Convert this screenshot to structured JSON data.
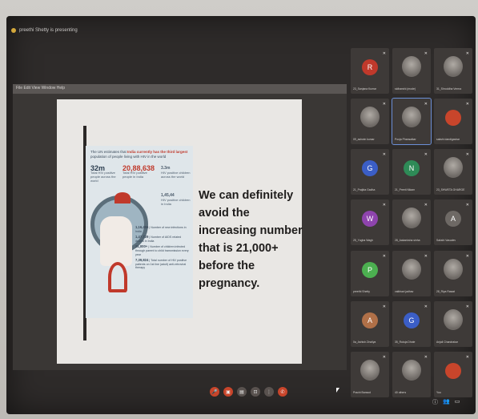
{
  "meeting": {
    "presenting_label": "preethi Shetty is presenting"
  },
  "share_window": {
    "menu_label": "File  Edit  View  Window  Help"
  },
  "infographic": {
    "headline_pre": "The UN estimates that ",
    "headline_emph": "India currently has the third largest",
    "headline_post": " population of people living with HIV in the world",
    "stat1_value": "32m",
    "stat1_label": "Total HIV positive people across the world",
    "stat2_value": "20,88,638",
    "stat2_label": "Total HIV positive people in India",
    "stat3_value": "3.3m",
    "stat3_label": "HIV positive children across the world",
    "stat4_value": "1,45,44",
    "stat4_label": "HIV positive children in India",
    "bullets": [
      {
        "value": "1,16,456",
        "label": "Number of new infections in India"
      },
      {
        "value": "1,47,729",
        "label": "Number of AIDS related deaths in India"
      },
      {
        "value": "21,000+",
        "label": "Number of children infected through parent to child transmission every year"
      },
      {
        "value": "7,39,824",
        "label": "Total number of HIV positive patients on 1st line (adult) anti-retroviral therapy"
      }
    ]
  },
  "slide_text": "We can definitely avoid the increasing number that is 21,000+ before the pregnancy.",
  "participants": [
    {
      "name": "23_Sanjana Kumar",
      "type": "avatar",
      "initial": "R",
      "color": "#c0392b"
    },
    {
      "name": "sidhanshi (mode)",
      "type": "photo"
    },
    {
      "name": "31_Shruddha Verma",
      "type": "photo"
    },
    {
      "name": "09_ashwin kumar",
      "type": "photo"
    },
    {
      "name": "Pooja Phansalkar",
      "type": "photo",
      "pinned": true
    },
    {
      "name": "sakshi dandigavkar",
      "type": "avatar",
      "initial": "",
      "color": "#c8452b"
    },
    {
      "name": "21_Prajkta Gadha",
      "type": "avatar",
      "initial": "G",
      "color": "#3b5ec6"
    },
    {
      "name": "21_Preeti Nikam",
      "type": "avatar",
      "initial": "N",
      "color": "#2e8b57"
    },
    {
      "name": "23_SHWETA GHARGE",
      "type": "photo"
    },
    {
      "name": "25_Yugha Wagh",
      "type": "avatar",
      "initial": "W",
      "color": "#8e44ad"
    },
    {
      "name": "28_Aakanksha sinha",
      "type": "photo"
    },
    {
      "name": "Sakshi Vasudev",
      "type": "avatar",
      "initial": "A",
      "color": "#6e6965"
    },
    {
      "name": "preethi Shetty",
      "type": "avatar",
      "initial": "P",
      "color": "#4caf50"
    },
    {
      "name": "vaibhavi jadhav",
      "type": "photo"
    },
    {
      "name": "28_Riya Rawat",
      "type": "photo"
    },
    {
      "name": "0a_Ashish Zinzilya",
      "type": "avatar",
      "initial": "A",
      "color": "#b07048"
    },
    {
      "name": "35_Rutuja Dhote",
      "type": "avatar",
      "initial": "G",
      "color": "#3b5ec6"
    },
    {
      "name": "Anjali Chandrakar",
      "type": "photo"
    },
    {
      "name": "Prachi Bansod",
      "type": "photo"
    },
    {
      "name": "40 others",
      "type": "photo"
    },
    {
      "name": "You",
      "type": "avatar",
      "initial": "",
      "color": "#c8452b"
    }
  ],
  "controls": [
    {
      "name": "mic-button",
      "glyph": "🎤",
      "red": true
    },
    {
      "name": "camera-button",
      "glyph": "▣",
      "red": true
    },
    {
      "name": "captions-button",
      "glyph": "▤",
      "red": false
    },
    {
      "name": "present-button",
      "glyph": "⊡",
      "red": false
    },
    {
      "name": "more-button",
      "glyph": "⋮",
      "red": false
    },
    {
      "name": "leave-button",
      "glyph": "✆",
      "red": true
    }
  ]
}
